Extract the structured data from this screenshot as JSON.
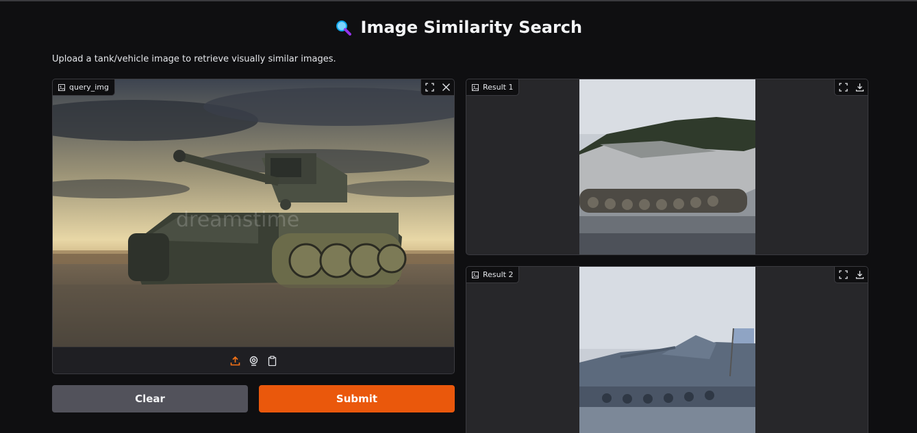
{
  "header": {
    "title_icon": "magnifier-icon",
    "title": "Image Similarity Search",
    "description": "Upload a tank/vehicle image to retrieve visually similar images."
  },
  "query_panel": {
    "label": "query_img",
    "image_description_icon": "image-icon",
    "toolbar_icons": [
      "upload-icon",
      "webcam-icon",
      "clipboard-icon"
    ],
    "top_icons": [
      "fullscreen-icon",
      "close-icon"
    ],
    "watermark": "dreamstime"
  },
  "results": [
    {
      "label": "Result 1",
      "top_icons": [
        "fullscreen-icon",
        "download-icon"
      ]
    },
    {
      "label": "Result 2",
      "top_icons": [
        "fullscreen-icon",
        "download-icon"
      ]
    }
  ],
  "buttons": {
    "clear_label": "Clear",
    "submit_label": "Submit"
  },
  "colors": {
    "accent": "#ea580c",
    "secondary_button": "#52525b",
    "background": "#0f0f11",
    "panel": "#1f1f23"
  }
}
